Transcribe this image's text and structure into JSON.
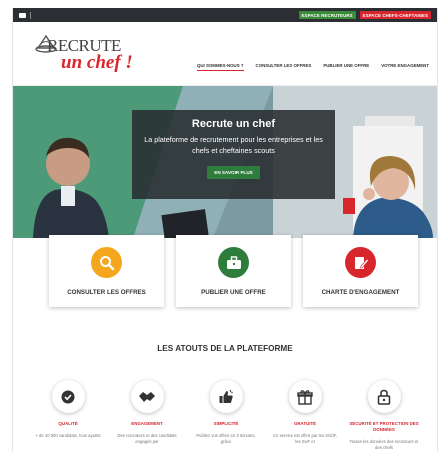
{
  "topbar": {
    "icon": "mail-icon",
    "recruteurs_label": "ESPACE RECRUTEURS",
    "chefs_label": "ESPACE CHEFS-CHEFTAINES",
    "colors": {
      "green": "#3a8a3a",
      "red": "#d8262f"
    }
  },
  "logo": {
    "line1": "RECRUTE",
    "line2": "un chef !"
  },
  "nav": [
    {
      "label": "QUI SOMMES-NOUS ?"
    },
    {
      "label": "CONSULTER LES OFFRES"
    },
    {
      "label": "PUBLIER UNE OFFRE"
    },
    {
      "label": "VOTRE ENGAGEMENT"
    }
  ],
  "hero": {
    "title": "Recrute un chef",
    "subtitle": "La plateforme de recrutement pour les entreprises et les chefs et cheftaines scouts",
    "button": "EN SAVOIR PLUS"
  },
  "cards": [
    {
      "label": "CONSULTER LES OFFRES",
      "icon": "search-icon",
      "color": "#f4a71d"
    },
    {
      "label": "PUBLIER UNE OFFRE",
      "icon": "briefcase-icon",
      "color": "#2f7d3c"
    },
    {
      "label": "CHARTE D'ENGAGEMENT",
      "icon": "edit-document-icon",
      "color": "#d8262f"
    }
  ],
  "section": {
    "title": "LES ATOUTS DE LA PLATEFORME"
  },
  "atouts": [
    {
      "title": "QUALITÉ",
      "text": "+ de 10 000 candidats, tous ayants",
      "icon": "badge-check-icon"
    },
    {
      "title": "ENGAGEMENT",
      "text": "Des recruteurs et des candidats engagés par",
      "icon": "handshake-icon"
    },
    {
      "title": "SIMPLICITÉ",
      "text": "Publiez vos offres en 3 minutes, grâce",
      "icon": "thumbs-up-icon"
    },
    {
      "title": "GRATUITÉ",
      "text": "Ce service est offert par les SGdF, les SUF et",
      "icon": "gift-icon"
    },
    {
      "title": "SÉCURITÉ ET PROTECTION DES DONNÉES",
      "text": "Toutes les données des recruteurs et des chefs",
      "icon": "lock-icon"
    }
  ]
}
